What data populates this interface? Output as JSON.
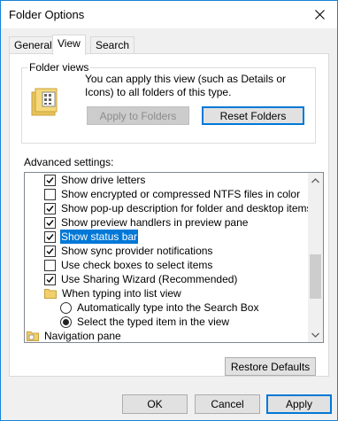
{
  "window": {
    "title": "Folder Options",
    "close_icon": "close-icon"
  },
  "tabs": [
    {
      "label": "General",
      "active": false
    },
    {
      "label": "View",
      "active": true
    },
    {
      "label": "Search",
      "active": false
    }
  ],
  "folder_views": {
    "group_label": "Folder views",
    "description": "You can apply this view (such as Details or Icons) to all folders of this type.",
    "icon": "folder-view-icon",
    "apply_button": "Apply to Folders",
    "reset_button": "Reset Folders"
  },
  "advanced": {
    "label": "Advanced settings:",
    "items": [
      {
        "type": "checkbox",
        "checked": true,
        "label": "Show drive letters"
      },
      {
        "type": "checkbox",
        "checked": false,
        "label": "Show encrypted or compressed NTFS files in color"
      },
      {
        "type": "checkbox",
        "checked": true,
        "label": "Show pop-up description for folder and desktop items"
      },
      {
        "type": "checkbox",
        "checked": true,
        "label": "Show preview handlers in preview pane"
      },
      {
        "type": "checkbox",
        "checked": true,
        "label": "Show status bar",
        "selected": true
      },
      {
        "type": "checkbox",
        "checked": true,
        "label": "Show sync provider notifications"
      },
      {
        "type": "checkbox",
        "checked": false,
        "label": "Use check boxes to select items"
      },
      {
        "type": "checkbox",
        "checked": true,
        "label": "Use Sharing Wizard (Recommended)"
      },
      {
        "type": "folder",
        "label": "When typing into list view"
      },
      {
        "type": "radio",
        "checked": false,
        "label": "Automatically type into the Search Box"
      },
      {
        "type": "radio",
        "checked": true,
        "label": "Select the typed item in the view"
      },
      {
        "type": "nav",
        "label": "Navigation pane"
      }
    ],
    "restore_button": "Restore Defaults"
  },
  "footer": {
    "ok": "OK",
    "cancel": "Cancel",
    "apply": "Apply"
  },
  "colors": {
    "accent": "#0078d7",
    "window_border": "#1883d7",
    "face": "#f0f0f0"
  }
}
